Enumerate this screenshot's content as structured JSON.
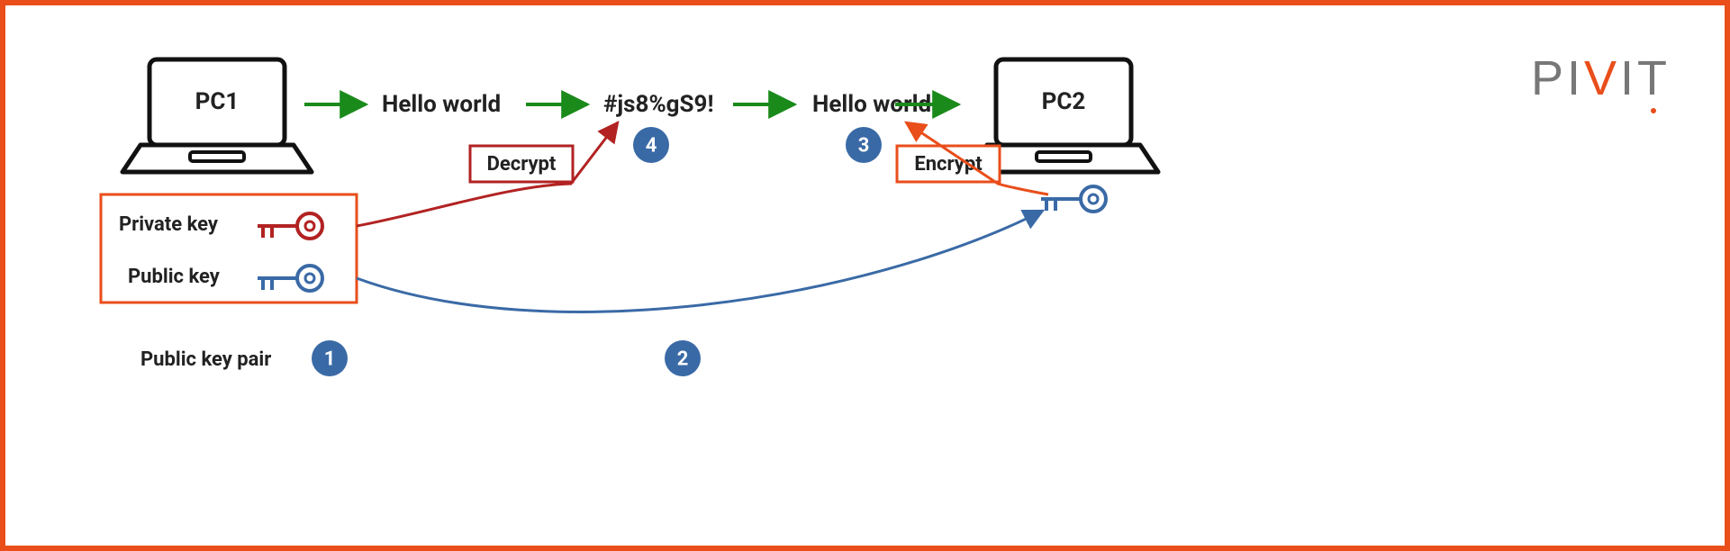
{
  "logo": {
    "text_before_v": "PI",
    "v": "V",
    "text_after_v": "IT"
  },
  "pc1_label": "PC1",
  "pc2_label": "PC2",
  "plaintext_sent": "Hello world",
  "ciphertext": "#js8%gS9!",
  "plaintext_received": "Hello world",
  "decrypt_label": "Decrypt",
  "encrypt_label": "Encrypt",
  "private_key_label": "Private key",
  "public_key_label": "Public key",
  "keypair_label": "Public key pair",
  "badges": {
    "one": "1",
    "two": "2",
    "three": "3",
    "four": "4"
  },
  "colors": {
    "frame": "#e94e1b",
    "flow_arrow": "#1a8a1a",
    "decrypt": "#b22222",
    "encrypt": "#e94e1b",
    "public_key": "#3a6aa6",
    "badge": "#3a6aa6",
    "private_key": "#b22222",
    "keybox": "#e94e1b"
  }
}
